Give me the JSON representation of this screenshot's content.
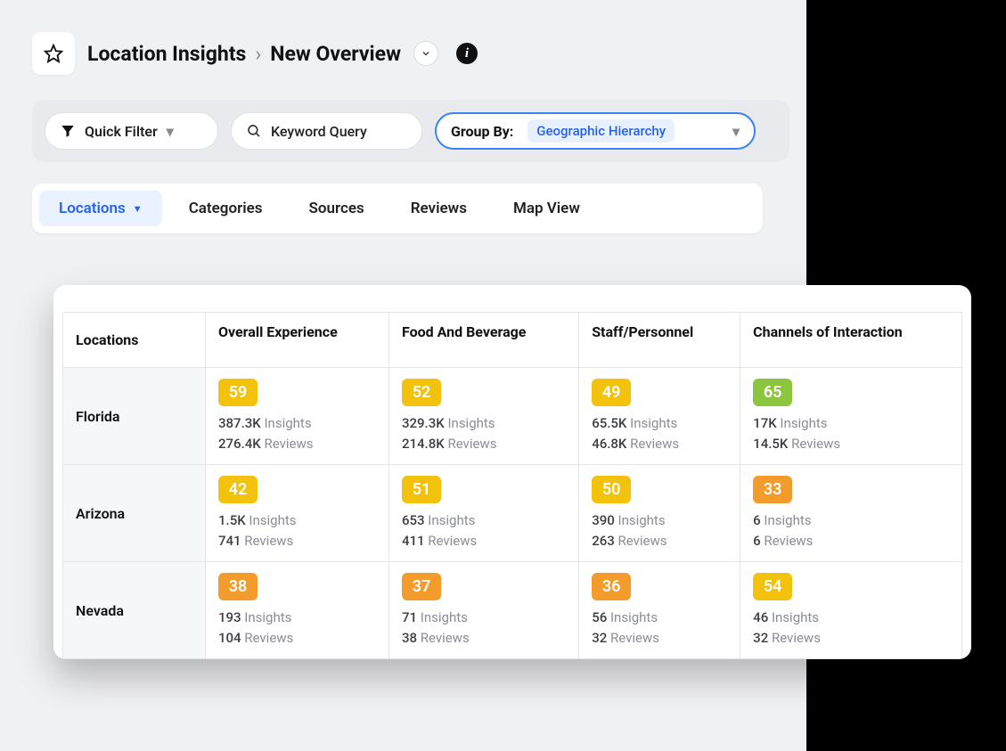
{
  "breadcrumb": {
    "root": "Location Insights",
    "current": "New Overview"
  },
  "filters": {
    "quick_filter_label": "Quick Filter",
    "keyword_placeholder": "Keyword Query",
    "group_by_label": "Group By:",
    "group_by_value": "Geographic Hierarchy"
  },
  "tabs": [
    {
      "label": "Locations",
      "active": true,
      "has_dropdown": true
    },
    {
      "label": "Categories",
      "active": false,
      "has_dropdown": false
    },
    {
      "label": "Sources",
      "active": false,
      "has_dropdown": false
    },
    {
      "label": "Reviews",
      "active": false,
      "has_dropdown": false
    },
    {
      "label": "Map View",
      "active": false,
      "has_dropdown": false
    }
  ],
  "table": {
    "row_header": "Locations",
    "columns": [
      "Overall Experience",
      "Food And Beverage",
      "Staff/Personnel",
      "Channels of Interaction"
    ],
    "sub_labels": {
      "insights": "Insights",
      "reviews": "Reviews"
    },
    "rows": [
      {
        "location": "Florida",
        "cells": [
          {
            "score": "59",
            "color": "yellow",
            "insights": "387.3K",
            "reviews": "276.4K"
          },
          {
            "score": "52",
            "color": "yellow",
            "insights": "329.3K",
            "reviews": "214.8K"
          },
          {
            "score": "49",
            "color": "yellow",
            "insights": "65.5K",
            "reviews": "46.8K"
          },
          {
            "score": "65",
            "color": "green",
            "insights": "17K",
            "reviews": "14.5K"
          }
        ]
      },
      {
        "location": "Arizona",
        "cells": [
          {
            "score": "42",
            "color": "yellow",
            "insights": "1.5K",
            "reviews": "741"
          },
          {
            "score": "51",
            "color": "yellow",
            "insights": "653",
            "reviews": "411"
          },
          {
            "score": "50",
            "color": "yellow",
            "insights": "390",
            "reviews": "263"
          },
          {
            "score": "33",
            "color": "orange",
            "insights": "6",
            "reviews": "6"
          }
        ]
      },
      {
        "location": "Nevada",
        "cells": [
          {
            "score": "38",
            "color": "orange",
            "insights": "193",
            "reviews": "104"
          },
          {
            "score": "37",
            "color": "orange",
            "insights": "71",
            "reviews": "38"
          },
          {
            "score": "36",
            "color": "orange",
            "insights": "56",
            "reviews": "32"
          },
          {
            "score": "54",
            "color": "yellow",
            "insights": "46",
            "reviews": "32"
          }
        ]
      }
    ]
  }
}
